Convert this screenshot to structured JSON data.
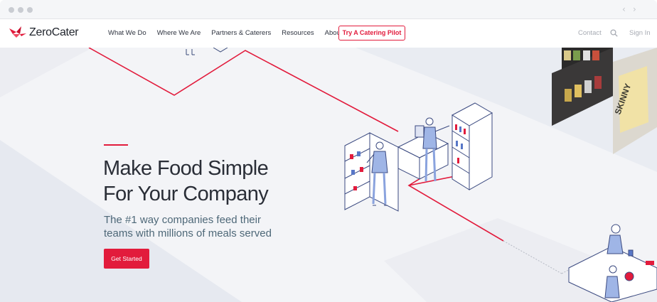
{
  "browser": {
    "back_glyph": "‹",
    "forward_glyph": "›"
  },
  "brand": {
    "name": "ZeroCater",
    "accent_color": "#e21b3c",
    "logo_icon": "crane-logo-icon"
  },
  "nav": {
    "items": [
      {
        "label": "What We Do"
      },
      {
        "label": "Where We Are"
      },
      {
        "label": "Partners & Caterers"
      },
      {
        "label": "Resources"
      },
      {
        "label": "About"
      }
    ],
    "cta_label": "Try A Catering Pilot",
    "contact_label": "Contact",
    "search_icon": "search-icon",
    "signin_label": "Sign In"
  },
  "hero": {
    "headline_line1": "Make Food Simple",
    "headline_line2": "For Your Company",
    "subhead_line1": "The #1 way companies feed their",
    "subhead_line2": "teams with millions of meals served",
    "cta_label": "Get Started",
    "snack_bag_text": "SKINNY"
  }
}
